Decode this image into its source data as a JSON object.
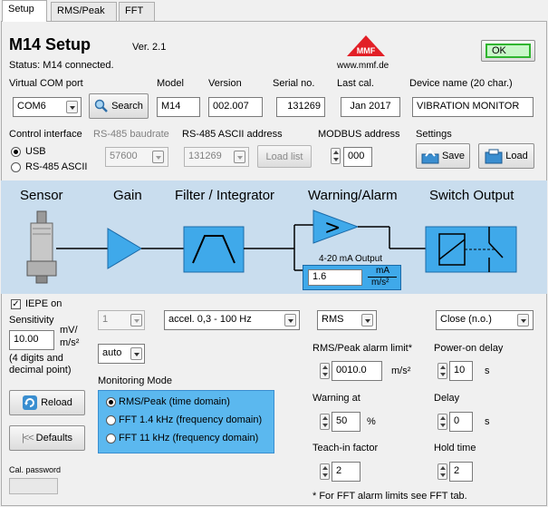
{
  "tabs": [
    "Setup",
    "RMS/Peak",
    "FFT"
  ],
  "header": {
    "title": "M14 Setup",
    "version": "Ver. 2.1",
    "status": "Status:  M14 connected.",
    "logo_text": "MMF",
    "url": "www.mmf.de",
    "ok_label": "OK"
  },
  "row1": {
    "com_label": "Virtual COM port",
    "com_value": "COM6",
    "search_label": "Search",
    "model_label": "Model",
    "model_value": "M14",
    "version_label": "Version",
    "version_value": "002.007",
    "serial_label": "Serial no.",
    "serial_value": "131269",
    "lastcal_label": "Last cal.",
    "lastcal_value": "Jan 2017",
    "devname_label": "Device name (20 char.)",
    "devname_value": "VIBRATION MONITOR"
  },
  "row2": {
    "ci_label": "Control interface",
    "baud_label": "RS-485 baudrate",
    "ascii_label": "RS-485 ASCII  address",
    "modbus_label": "MODBUS address",
    "settings_label": "Settings",
    "usb_label": "USB",
    "rs485_label": "RS-485 ASCII",
    "baud_value": "57600",
    "ascii_value": "131269",
    "loadlist_label": "Load list",
    "modbus_value": "000",
    "save_label": "Save",
    "load_label": "Load"
  },
  "diagram": {
    "sensor": "Sensor",
    "gain": "Gain",
    "filter": "Filter / Integrator",
    "warning": "Warning/Alarm",
    "switch": "Switch Output",
    "output_label": "4-20 mA Output",
    "output_value": "1.6",
    "output_unit_top": "mA",
    "output_unit_bottom": "m/s²"
  },
  "sensor_panel": {
    "iepe_label": "IEPE on",
    "sens_label": "Sensitivity",
    "sens_value": "10.00",
    "unit_top": "mV/",
    "unit_bottom": "m/s²",
    "note1": "(4 digits and",
    "note2": "decimal point)",
    "reload_label": "Reload",
    "defaults_label": "Defaults",
    "calpw_label": "Cal. password"
  },
  "gain_panel": {
    "gain_value": "1",
    "auto_value": "auto"
  },
  "filter_panel": {
    "filter_value": "accel. 0,3 - 100 Hz"
  },
  "monitoring": {
    "title": "Monitoring Mode",
    "options": [
      "RMS/Peak (time domain)",
      "FFT 1.4 kHz (frequency domain)",
      "FFT 11 kHz (frequency domain)"
    ]
  },
  "alarm_panel": {
    "mode_value": "RMS",
    "limit_label": "RMS/Peak alarm limit*",
    "limit_value": "0010.0",
    "limit_unit": "m/s²",
    "warning_label": "Warning at",
    "warning_value": "50",
    "warning_unit": "%",
    "teach_label": "Teach-in factor",
    "teach_value": "2",
    "footnote": "* For FFT alarm limits see FFT tab."
  },
  "switch_panel": {
    "switch_value": "Close (n.o.)",
    "poweron_label": "Power-on delay",
    "poweron_value": "10",
    "poweron_unit": "s",
    "delay_label": "Delay",
    "delay_value": "0",
    "delay_unit": "s",
    "hold_label": "Hold time",
    "hold_value": "2"
  },
  "colors": {
    "accent_blue": "#5bb8ef",
    "block_blue": "#3fa9ea",
    "panel_blue": "#c9ddee",
    "ok_green": "#2fb52f"
  }
}
